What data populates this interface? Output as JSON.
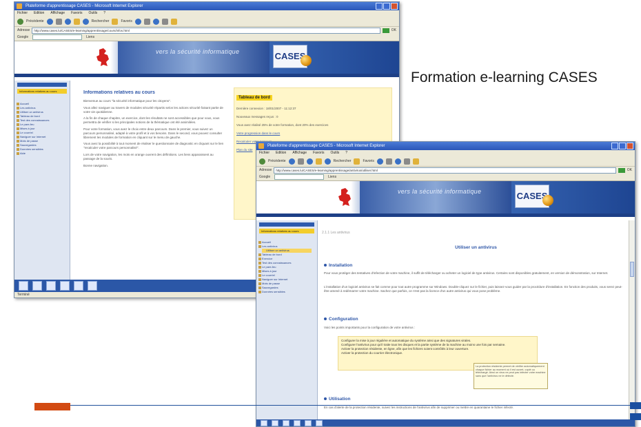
{
  "slide": {
    "caption": "Formation e-learning CASES"
  },
  "window1": {
    "title": "Plateforme d'apprentissage CASES - Microsoft Internet Explorer",
    "menu": [
      "Fichier",
      "Edition",
      "Affichage",
      "Favoris",
      "Outils",
      "?"
    ],
    "toolbar": {
      "back": "Précédente",
      "search": "Rechercher",
      "favorites": "Favoris"
    },
    "address": "http://www.cases.lu/CASES/e-learning/apprentissage/cours/infos.html",
    "address_label": "Adresse",
    "go_label": "OK",
    "links_label": "Liens",
    "google_label": "Google",
    "banner_slogan": "vers la sécurité informatique",
    "logo_text": "CASES",
    "sidebar": {
      "active": "Informations relatives au cours",
      "items": [
        "Accueil",
        "Les antivirus",
        "Utiliser un antivirus",
        "Tableau de bord",
        "Test des connaissances",
        "Le pare-feu",
        "Mises à jour",
        "Le courriel",
        "Naviguer sur Internet",
        "Mots de passe",
        "Sauvegardes",
        "Données sensibles",
        "Aide"
      ]
    },
    "content": {
      "title": "Informations relatives au cours",
      "paragraphs": [
        "Bienvenue au cours \"la sécurité informatique pour les citoyens\".",
        "Vous allez naviguer au travers de modules sécurité répartis selon les actions sécurité faisant partie de votre vie quotidienne.",
        "A la fin de chaque chapitre, un exercice, dont les résultats ne sont accessibles que pour vous, vous permettra de vérifier si les principales notions de la thématique ont été assimilées.",
        "Pour votre formation, vous avez le choix entre deux parcours. Dans le premier, vous suivez un parcours personnalisé, adapté à votre profil et à vos besoins. Dans le second, vous pouvez consulter librement les modules de formation en cliquant sur le menu de gauche.",
        "Vous avez la possibilité à tout moment de réaliser le questionnaire de diagnostic en cliquant sur le lien \"recalculer votre parcours personnalisé\".",
        "Lors de votre navigation, les mots en orange ouvrent des définitions. Les liens apparaissent au passage de la souris.",
        "Bonne navigation."
      ]
    },
    "dashboard": {
      "title": "Tableau de bord",
      "last_connection": "Dernière connexion : 18/01/2007 - 11:12:37",
      "modules_done": "Nouveaux messages reçus : 0",
      "progress": "Vous avez réalisé 25% de votre formation, dont 20% des exercices",
      "link1": "Votre progression dans le cours",
      "link2": "Recalculer votre parcours",
      "link3": "Plan du site"
    },
    "status": "Terminé"
  },
  "window2": {
    "title": "Plateforme d'apprentissage CASES - Microsoft Internet Explorer",
    "menu": [
      "Fichier",
      "Edition",
      "Affichage",
      "Favoris",
      "Outils",
      "?"
    ],
    "toolbar": {
      "back": "Précédente",
      "search": "Rechercher",
      "favorites": "Favoris"
    },
    "address": "http://www.cases.lu/CASES/e-learning/apprentissage/antivirus/utiliser.html",
    "address_label": "Adresse",
    "go_label": "OK",
    "links_label": "Liens",
    "google_label": "Google",
    "banner_slogan": "vers la sécurité informatique",
    "logo_text": "CASES",
    "sidebar": {
      "active": "Informations relatives au cours",
      "items": [
        "Accueil",
        "Les antivirus",
        "Utiliser un antivirus",
        "Tableau de bord",
        "Exercice",
        "Test des connaissances",
        "Le pare-feu",
        "Mises à jour",
        "Le courriel",
        "Naviguer sur Internet",
        "Mots de passe",
        "Sauvegardes",
        "Données sensibles"
      ]
    },
    "breadcrumb": "2.1.1 Les antivirus",
    "page_title": "Utiliser un antivirus",
    "sections": {
      "installation": {
        "title": "Installation",
        "p1": "Pour vous protéger des tentatives d'infection de votre machine, il suffit de télécharger ou acheter un logiciel de type antivirus. Certains sont disponibles gratuitement, en version de démonstration, sur Internet.",
        "p2": "L'installation d'un logiciel antivirus se fait comme pour tout autre programme sur Windows. Double-cliquez sur le fichier, puis laissez-vous guider par la procédure d'installation. En fonction des produits, vous serez peut-être amené à redémarrer votre machine. Sachez que parfois, ce n'est pas la licence d'un autre antivirus qui vous pose problème."
      },
      "configuration": {
        "title": "Configuration",
        "p1": "Voici les points importants pour la configuration de votre antivirus :",
        "box_lines": [
          "Configurer la mise à jour régulière et automatique du système ainsi que des signatures virales.",
          "Configurer l'antivirus pour qu'il traite tous les disques et la partie système de la machine au moins une fois par semaine.",
          "Activer la protection résidente, en ligne, afin que les fichiers soient contrôlés à leur ouverture.",
          "Activer la protection du courrier électronique."
        ],
        "tooltip": "La protection résidente permet de vérifier automatiquement chaque fichier au moment où il est ouvert, copié ou téléchargé. Ainsi un virus ne peut pas infecter votre machine sans que l'antivirus ne le détecte."
      },
      "utilisation": {
        "title": "Utilisation",
        "p1": "En cas d'alerte de la protection résidente, suivez les instructions de l'antivirus afin de supprimer ou mettre en quarantaine le fichier infecté."
      }
    }
  }
}
